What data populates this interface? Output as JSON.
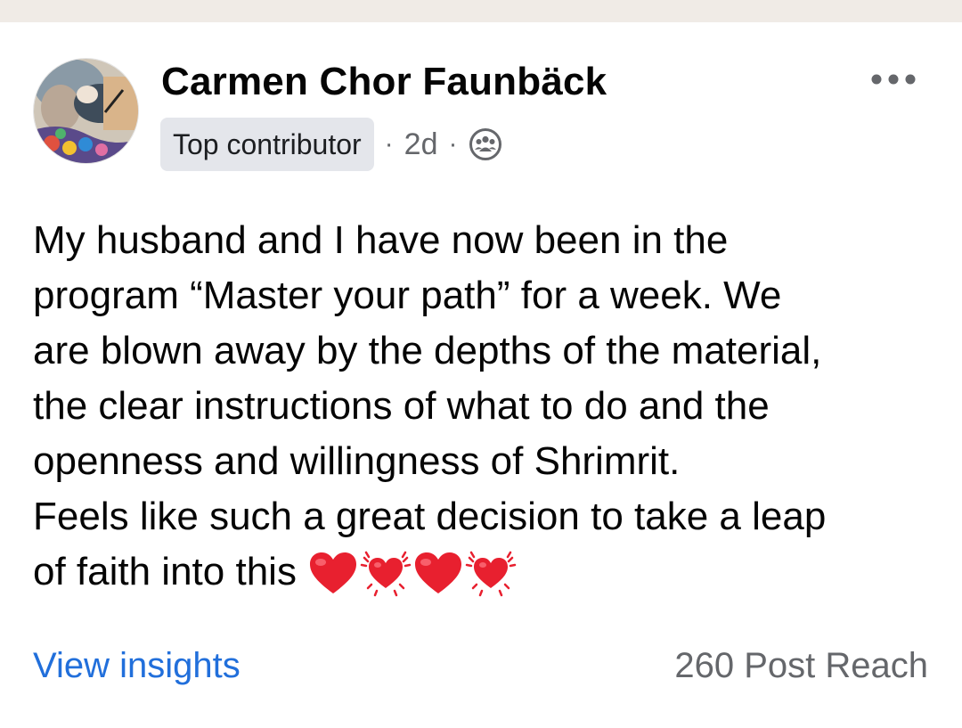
{
  "post": {
    "author": {
      "name": "Carmen Chor Faunbäck",
      "badge": "Top contributor"
    },
    "time": "2d",
    "separator": "·",
    "privacy_icon": "group-icon",
    "menu_icon": "more-horizontal-icon",
    "body_lines": [
      "My husband and I have now been in the",
      "program “Master your path” for a week. We",
      "are blown away by the depths of the material,",
      "the clear instructions of what to do and the",
      "openness and willingness of Shrimrit.",
      "Feels like such a great decision to take a leap",
      "of faith into this"
    ],
    "emojis": [
      "red-heart",
      "beating-heart",
      "red-heart",
      "beating-heart"
    ]
  },
  "footer": {
    "insights_label": "View insights",
    "reach_label": "260 Post Reach"
  },
  "colors": {
    "link_blue": "#216fdb",
    "meta_gray": "#65676b",
    "badge_bg": "#e4e6eb",
    "heart_red": "#e8202f"
  }
}
